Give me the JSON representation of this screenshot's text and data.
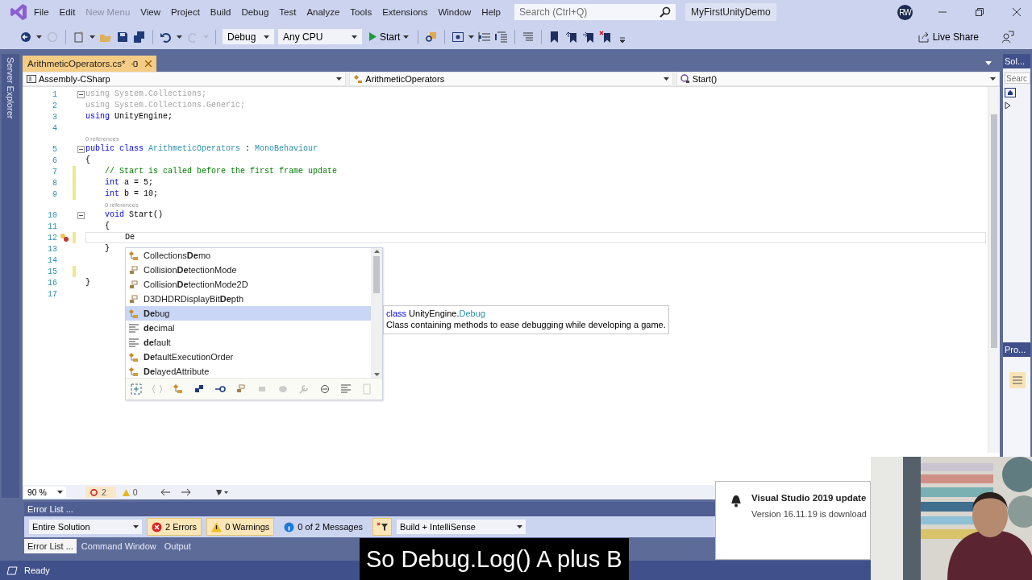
{
  "menu_bar": {
    "items": [
      {
        "label": "File",
        "disabled": false
      },
      {
        "label": "Edit",
        "disabled": false
      },
      {
        "label": "New Menu",
        "disabled": true
      },
      {
        "label": "View",
        "disabled": false
      },
      {
        "label": "Project",
        "disabled": false
      },
      {
        "label": "Build",
        "disabled": false
      },
      {
        "label": "Debug",
        "disabled": false
      },
      {
        "label": "Test",
        "disabled": false
      },
      {
        "label": "Analyze",
        "disabled": false
      },
      {
        "label": "Tools",
        "disabled": false
      },
      {
        "label": "Extensions",
        "disabled": false
      },
      {
        "label": "Window",
        "disabled": false
      },
      {
        "label": "Help",
        "disabled": false
      }
    ],
    "search": {
      "placeholder": "Search (Ctrl+Q)"
    },
    "project_name": "MyFirstUnityDemo",
    "avatar": "RW"
  },
  "toolbar": {
    "configuration": "Debug",
    "platform": "Any CPU",
    "start": "Start",
    "live_share": "Live Share"
  },
  "side_tabs": [
    {
      "label": "Server Explorer"
    }
  ],
  "editor_tabs": [
    {
      "label": "ArithmeticOperators.cs*",
      "selected": true
    }
  ],
  "nav_bar": [
    "Assembly-CSharp",
    "ArithmeticOperators",
    "Start()"
  ],
  "code_lines": [
    {
      "number": "1",
      "tokens": [
        {
          "kind": "faded",
          "text": "using System.Collections;"
        }
      ],
      "foldable": true,
      "changed": false,
      "current": false
    },
    {
      "number": "2",
      "tokens": [
        {
          "kind": "faded",
          "text": "using System.Collections.Generic;"
        }
      ],
      "foldable": false,
      "changed": false,
      "current": false
    },
    {
      "number": "3",
      "tokens": [
        {
          "kind": "keyword",
          "text": "using"
        },
        {
          "kind": "plain",
          "text": " UnityEngine;"
        }
      ],
      "foldable": false,
      "changed": false,
      "current": false
    },
    {
      "number": "4",
      "foldable": false,
      "changed": false,
      "current": false
    },
    {
      "number": "5",
      "lens": "0 references",
      "tokens": [
        {
          "kind": "keyword",
          "text": "public class "
        },
        {
          "kind": "type",
          "text": "ArithmeticOperators"
        },
        {
          "kind": "plain",
          "text": " : "
        },
        {
          "kind": "type",
          "text": "MonoBehaviour"
        }
      ],
      "foldable": true,
      "changed": false,
      "current": false
    },
    {
      "number": "6",
      "tokens": [
        {
          "kind": "plain",
          "text": "{"
        }
      ],
      "foldable": false,
      "changed": false,
      "current": false
    },
    {
      "number": "7",
      "tokens": [
        {
          "kind": "comment",
          "text": "    // Start is called before the first frame update"
        }
      ],
      "foldable": false,
      "changed": true,
      "current": false
    },
    {
      "number": "8",
      "tokens": [
        {
          "kind": "keyword",
          "text": "    int"
        },
        {
          "kind": "plain",
          "text": " a = 5;"
        }
      ],
      "foldable": false,
      "changed": true,
      "current": false
    },
    {
      "number": "9",
      "tokens": [
        {
          "kind": "keyword",
          "text": "    int"
        },
        {
          "kind": "plain",
          "text": " b = 10;"
        }
      ],
      "foldable": false,
      "changed": true,
      "current": false
    },
    {
      "number": "10",
      "lens": "0 references",
      "tokens": [
        {
          "kind": "keyword",
          "text": "    void"
        },
        {
          "kind": "plain",
          "text": " Start()"
        }
      ],
      "foldable": true,
      "changed": false,
      "current": false
    },
    {
      "number": "11",
      "tokens": [
        {
          "kind": "plain",
          "text": "    {"
        }
      ],
      "foldable": false,
      "changed": false,
      "current": false
    },
    {
      "number": "12",
      "tokens": [
        {
          "kind": "plain",
          "text": "        De"
        }
      ],
      "foldable": false,
      "changed": true,
      "current": true
    },
    {
      "number": "13",
      "tokens": [
        {
          "kind": "plain",
          "text": "    }"
        }
      ],
      "foldable": false,
      "changed": false,
      "current": false
    },
    {
      "number": "14",
      "foldable": false,
      "changed": false,
      "current": false
    },
    {
      "number": "15",
      "foldable": false,
      "changed": true,
      "current": false
    },
    {
      "number": "16",
      "tokens": [
        {
          "kind": "plain",
          "text": "}"
        }
      ],
      "foldable": false,
      "changed": false,
      "current": false
    },
    {
      "number": "17",
      "foldable": false,
      "changed": false,
      "current": false
    }
  ],
  "completion": {
    "items": [
      {
        "text": "Collections**De**mo",
        "kind": "class",
        "selected": false
      },
      {
        "text": "Collision**De**tectionMode",
        "kind": "enum",
        "selected": false
      },
      {
        "text": "Collision**De**tectionMode2D",
        "kind": "enum",
        "selected": false
      },
      {
        "text": "D3DHDRDisplayBit**De**pth",
        "kind": "enum",
        "selected": false
      },
      {
        "text": "**De**bug",
        "kind": "class",
        "selected": true
      },
      {
        "text": "**de**cimal",
        "kind": "keyword",
        "selected": false
      },
      {
        "text": "**de**fault",
        "kind": "keyword",
        "selected": false
      },
      {
        "text": "**De**faultExecutionOrder",
        "kind": "class",
        "selected": false
      },
      {
        "text": "**De**layedAttribute",
        "kind": "class",
        "selected": false
      }
    ],
    "tooltip": {
      "signature": [
        {
          "kind": "keyword",
          "text": "class"
        },
        {
          "kind": "plain",
          "text": " UnityEngine."
        },
        {
          "kind": "type",
          "text": "Debug"
        }
      ],
      "description": "Class containing methods to ease debugging while developing a game."
    }
  },
  "editor_status": {
    "zoom": "90 %",
    "errors": "2",
    "warnings": "0"
  },
  "right_panel": {
    "tabs": [
      {
        "label": "Sol..."
      },
      {
        "label": "Pro..."
      }
    ],
    "search": {
      "placeholder": "Searc"
    }
  },
  "error_list": {
    "title": "Error List ...",
    "scope": "Entire Solution",
    "filters": [
      {
        "kind": "error",
        "label": "2 Errors",
        "selected": true
      },
      {
        "kind": "warning",
        "label": "0 Warnings",
        "selected": true
      },
      {
        "kind": "message",
        "label": "0 of 2 Messages",
        "selected": false
      }
    ],
    "source": "Build + IntelliSense",
    "tabs": [
      {
        "label": "Error List ...",
        "selected": true
      },
      {
        "label": "Command Window",
        "selected": false
      },
      {
        "label": "Output",
        "selected": false
      }
    ]
  },
  "status_bar": {
    "text": "Ready"
  },
  "notification": {
    "title": "Visual Studio 2019 update",
    "body": "Version 16.11.19 is download"
  },
  "webcam": {
    "kind": "picture"
  },
  "caption": "So Debug.Log() A plus B"
}
